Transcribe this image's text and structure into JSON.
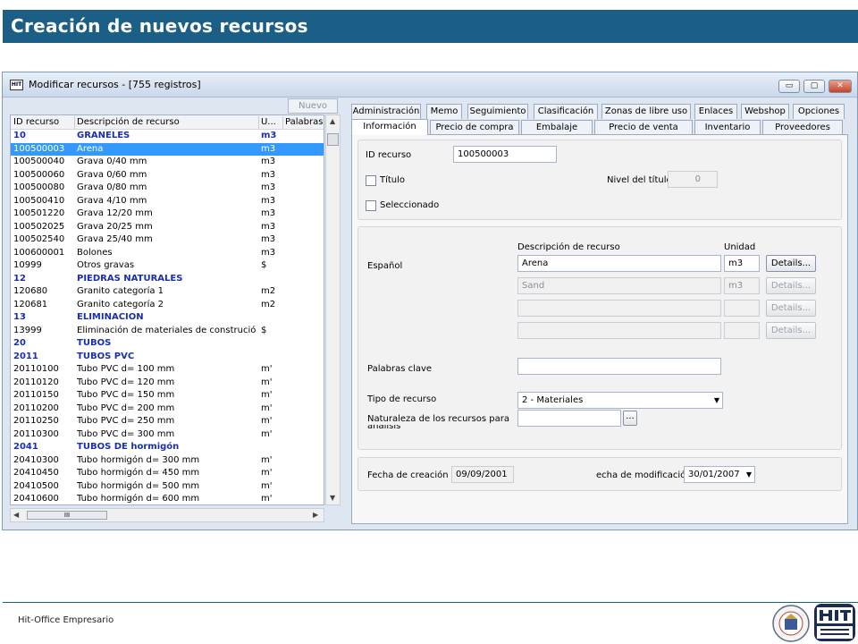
{
  "banner_title": "Creación de nuevos recursos",
  "footer_text": "Hit-Office Empresario",
  "window": {
    "title": "Modificar recursos - [755 registros]",
    "icon_text": "HIT",
    "controls": {
      "minimize": "▭",
      "maximize": "▢",
      "close": "✕"
    }
  },
  "left": {
    "new_button": "Nuevo",
    "columns": [
      "ID recurso",
      "Descripción de recurso",
      "U...",
      "Palabras c"
    ],
    "rows": [
      {
        "id": "10",
        "desc": "GRANELES",
        "unit": "m3",
        "type": "group"
      },
      {
        "id": "100500003",
        "desc": "Arena",
        "unit": "m3",
        "type": "selected"
      },
      {
        "id": "100500040",
        "desc": "Grava 0/40 mm",
        "unit": "m3",
        "type": ""
      },
      {
        "id": "100500060",
        "desc": "Grava 0/60 mm",
        "unit": "m3",
        "type": ""
      },
      {
        "id": "100500080",
        "desc": "Grava 0/80 mm",
        "unit": "m3",
        "type": ""
      },
      {
        "id": "100500410",
        "desc": "Grava 4/10 mm",
        "unit": "m3",
        "type": ""
      },
      {
        "id": "100501220",
        "desc": "Grava 12/20 mm",
        "unit": "m3",
        "type": ""
      },
      {
        "id": "100502025",
        "desc": "Grava 20/25 mm",
        "unit": "m3",
        "type": ""
      },
      {
        "id": "100502540",
        "desc": "Grava 25/40 mm",
        "unit": "m3",
        "type": ""
      },
      {
        "id": "100600001",
        "desc": "Bolones",
        "unit": "m3",
        "type": ""
      },
      {
        "id": "10999",
        "desc": "Otros gravas",
        "unit": "$",
        "type": ""
      },
      {
        "id": "12",
        "desc": "PIEDRAS NATURALES",
        "unit": "",
        "type": "group"
      },
      {
        "id": "120680",
        "desc": "Granito categoría 1",
        "unit": "m2",
        "type": ""
      },
      {
        "id": "120681",
        "desc": "Granito categoría 2",
        "unit": "m2",
        "type": ""
      },
      {
        "id": "13",
        "desc": "ELIMINACION",
        "unit": "",
        "type": "group"
      },
      {
        "id": "13999",
        "desc": "Eliminación de materiales de construción",
        "unit": "$",
        "type": ""
      },
      {
        "id": "20",
        "desc": "TUBOS",
        "unit": "",
        "type": "group"
      },
      {
        "id": "2011",
        "desc": "TUBOS PVC",
        "unit": "",
        "type": "group"
      },
      {
        "id": "20110100",
        "desc": "Tubo PVC  d= 100 mm",
        "unit": "m'",
        "type": ""
      },
      {
        "id": "20110120",
        "desc": "Tubo PVC  d= 120 mm",
        "unit": "m'",
        "type": ""
      },
      {
        "id": "20110150",
        "desc": "Tubo PVC  d= 150 mm",
        "unit": "m'",
        "type": ""
      },
      {
        "id": "20110200",
        "desc": "Tubo PVC  d= 200 mm",
        "unit": "m'",
        "type": ""
      },
      {
        "id": "20110250",
        "desc": "Tubo PVC  d= 250 mm",
        "unit": "m'",
        "type": ""
      },
      {
        "id": "20110300",
        "desc": "Tubo PVC  d= 300 mm",
        "unit": "m'",
        "type": ""
      },
      {
        "id": "2041",
        "desc": "TUBOS DE hormigón",
        "unit": "",
        "type": "group"
      },
      {
        "id": "20410300",
        "desc": "Tubo hormigón  d= 300 mm",
        "unit": "m'",
        "type": ""
      },
      {
        "id": "20410450",
        "desc": "Tubo hormigón  d= 450 mm",
        "unit": "m'",
        "type": ""
      },
      {
        "id": "20410500",
        "desc": "Tubo hormigón  d= 500 mm",
        "unit": "m'",
        "type": ""
      },
      {
        "id": "20410600",
        "desc": "Tubo hormigón  d= 600 mm",
        "unit": "m'",
        "type": ""
      }
    ],
    "hscroll_thumb": "III"
  },
  "tabs_row1": [
    "Administración",
    "Memo",
    "Seguimiento",
    "Clasificación",
    "Zonas de libre uso",
    "Enlaces",
    "Webshop",
    "Opciones"
  ],
  "tabs_row2": [
    "Información",
    "Precio de compra",
    "Embalaje",
    "Precio de venta",
    "Inventario",
    "Proveedores"
  ],
  "info": {
    "id_label": "ID recurso",
    "id_value": "100500003",
    "titulo_label": "Título",
    "nivel_label": "Nivel del título",
    "nivel_value": "0",
    "seleccionado_label": "Seleccionado",
    "desc_header": "Descripción de recurso",
    "unit_header": "Unidad",
    "lang_label": "Español",
    "desc_rows": [
      {
        "desc": "Arena",
        "unit": "m3",
        "enabled": true
      },
      {
        "desc": "Sand",
        "unit": "m3",
        "enabled": false
      },
      {
        "desc": "",
        "unit": "",
        "enabled": false
      },
      {
        "desc": "",
        "unit": "",
        "enabled": false
      }
    ],
    "details_label": "Details...",
    "keywords_label": "Palabras clave",
    "keywords_value": "",
    "type_label": "Tipo de recurso",
    "type_value": "2  - Materiales",
    "nature_label": "Naturaleza de los recursos para",
    "nature_label2": "análisis",
    "nature_value": "",
    "nature_btn": "...",
    "created_label": "Fecha de creación",
    "created_value": "09/09/2001",
    "modified_label": "echa de modificación",
    "modified_value": "30/01/2007"
  }
}
